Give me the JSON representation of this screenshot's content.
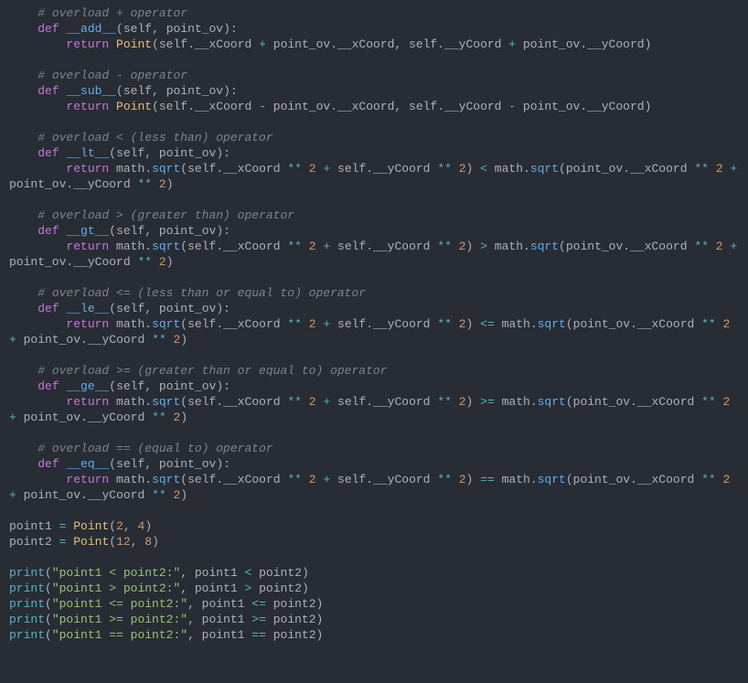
{
  "code": {
    "comments": {
      "add": "# overload + operator",
      "sub": "# overload - operator",
      "lt": "# overload < (less than) operator",
      "gt": "# overload > (greater than) operator",
      "le": "# overload <= (less than or equal to) operator",
      "ge": "# overload >= (greater than or equal to) operator",
      "eq": "# overload == (equal to) operator"
    },
    "keywords": {
      "def": "def",
      "return": "return"
    },
    "methods": {
      "add": "__add__",
      "sub": "__sub__",
      "lt": "__lt__",
      "gt": "__gt__",
      "le": "__le__",
      "ge": "__ge__",
      "eq": "__eq__"
    },
    "params": {
      "self": "self",
      "other": "point_ov"
    },
    "classPoint": "Point",
    "attrs": {
      "x": "__xCoord",
      "y": "__yCoord"
    },
    "math": "math",
    "sqrt": "sqrt",
    "numbers": {
      "two": "2",
      "four": "4",
      "eight": "8",
      "twelve": "12"
    },
    "ops": {
      "plus": "+",
      "minus": "-",
      "lt": "<",
      "gt": ">",
      "le": "<=",
      "ge": ">=",
      "eq": "==",
      "pow": "**",
      "assign": "="
    },
    "vars": {
      "p1": "point1",
      "p2": "point2"
    },
    "print": "print",
    "strings": {
      "lt": "\"point1 < point2:\"",
      "gt": "\"point1 > point2:\"",
      "le": "\"point1 <= point2:\"",
      "ge": "\"point1 >= point2:\"",
      "eq": "\"point1 == point2:\""
    }
  }
}
